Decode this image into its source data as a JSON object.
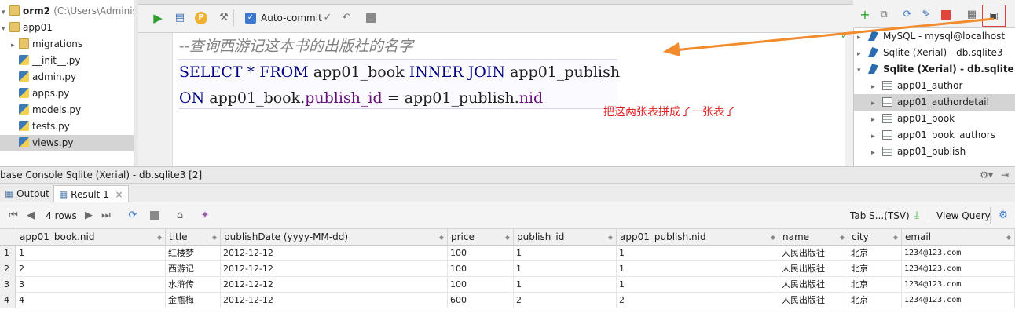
{
  "project": {
    "root_name": "orm2",
    "root_path": "C:\\Users\\Administrat",
    "items": [
      {
        "label": "app01",
        "icon": "folder-icon"
      },
      {
        "label": "migrations",
        "icon": "folder-icon"
      },
      {
        "label": "__init__.py",
        "icon": "python-file-icon"
      },
      {
        "label": "admin.py",
        "icon": "python-file-icon"
      },
      {
        "label": "apps.py",
        "icon": "python-file-icon"
      },
      {
        "label": "models.py",
        "icon": "python-file-icon"
      },
      {
        "label": "tests.py",
        "icon": "python-file-icon"
      },
      {
        "label": "views.py",
        "icon": "python-file-icon"
      }
    ]
  },
  "toolbar": {
    "auto_commit_label": "Auto-commit"
  },
  "editor": {
    "comment": "--查询西游记这本书的出版社的名字",
    "line1": {
      "select": "SELECT",
      "star": "*",
      "from": "FROM",
      "t1": "app01_book",
      "inner": "INNER",
      "join": "JOIN",
      "t2": "app01_publish"
    },
    "line2": {
      "on": "ON",
      "t1": "app01_book.",
      "f1": "publish_id",
      "eq": "=",
      "t2": "app01_publish.",
      "f2": "nid"
    },
    "annotation": "把这两张表拼成了一张表了"
  },
  "db_tree": {
    "items": [
      {
        "label": "MySQL - mysql@localhost"
      },
      {
        "label": "Sqlite (Xerial) - db.sqlite3"
      },
      {
        "label": "Sqlite (Xerial) - db.sqlite"
      },
      {
        "label": "app01_author"
      },
      {
        "label": "app01_authordetail"
      },
      {
        "label": "app01_book"
      },
      {
        "label": "app01_book_authors"
      },
      {
        "label": "app01_publish"
      }
    ]
  },
  "console": {
    "title": "base Console Sqlite (Xerial) - db.sqlite3 [2]",
    "tabs": {
      "output": "Output",
      "result": "Result 1"
    },
    "rows_label": "4 rows",
    "export_label": "Tab S...(TSV)",
    "view_query_label": "View Query"
  },
  "grid": {
    "columns": [
      "app01_book.nid",
      "title",
      "publishDate (yyyy-MM-dd)",
      "price",
      "publish_id",
      "app01_publish.nid",
      "name",
      "city",
      "email"
    ],
    "rows": [
      {
        "num": "1",
        "cells": [
          "1",
          "红楼梦",
          "2012-12-12",
          "100",
          "1",
          "1",
          "人民出版社",
          "北京",
          "1234@123.com"
        ]
      },
      {
        "num": "2",
        "cells": [
          "2",
          "西游记",
          "2012-12-12",
          "100",
          "1",
          "1",
          "人民出版社",
          "北京",
          "1234@123.com"
        ]
      },
      {
        "num": "3",
        "cells": [
          "3",
          "水浒传",
          "2012-12-12",
          "100",
          "1",
          "1",
          "人民出版社",
          "北京",
          "1234@123.com"
        ]
      },
      {
        "num": "4",
        "cells": [
          "4",
          "金瓶梅",
          "2012-12-12",
          "600",
          "2",
          "2",
          "人民出版社",
          "北京",
          "1234@123.com"
        ]
      }
    ]
  },
  "colors": {
    "accent": "#f28b2c",
    "keyword": "#000080",
    "field": "#660e7a",
    "annotation": "#e02020"
  }
}
